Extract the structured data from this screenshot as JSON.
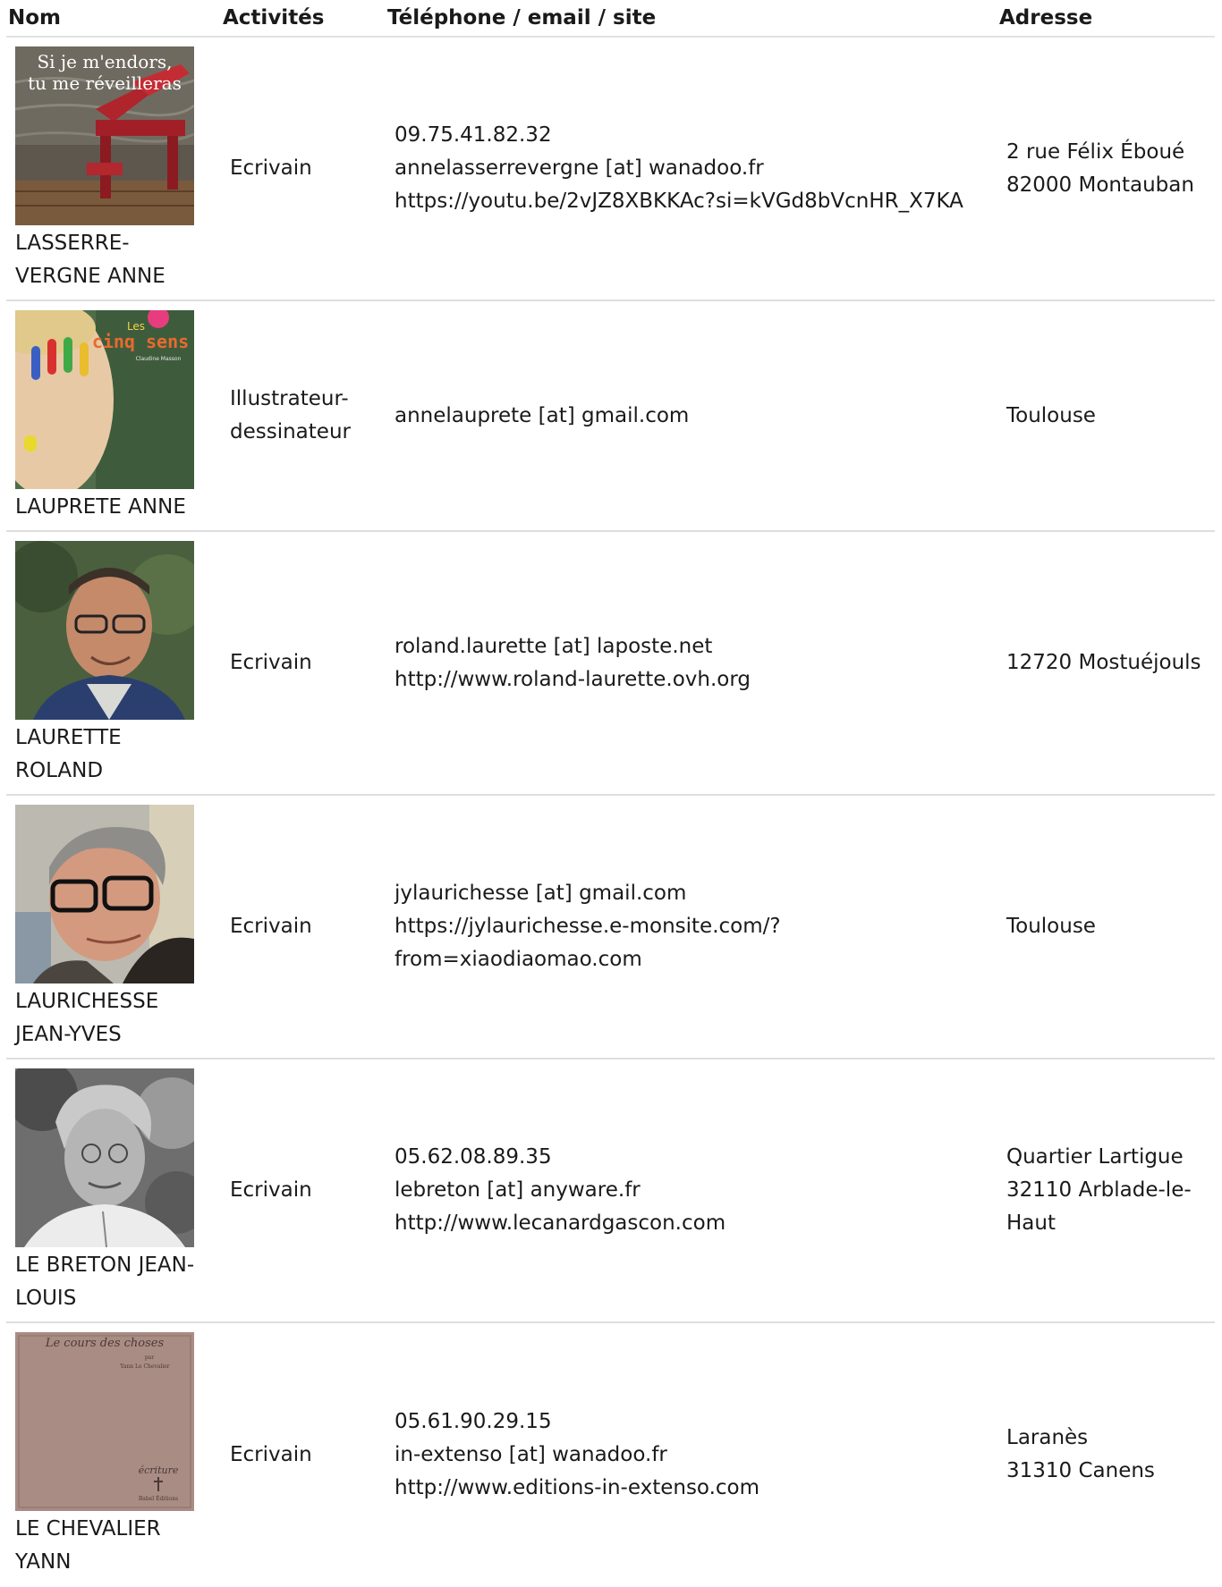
{
  "table": {
    "headers": {
      "nom": "Nom",
      "activites": "Activités",
      "contact": "Téléphone / email / site",
      "adresse": "Adresse"
    },
    "rows": [
      {
        "name": "LASSERRE-VERGNE ANNE",
        "photo_text": [
          "Si je m'endors,",
          "tu me réveilleras"
        ],
        "activity": "Ecrivain",
        "contact": [
          "09.75.41.82.32",
          "annelasserrevergne [at] wanadoo.fr",
          "https://youtu.be/2vJZ8XBKKAc?si=kVGd8bVcnHR_X7KA"
        ],
        "address": [
          "2 rue Félix Éboué",
          "82000 Montauban"
        ]
      },
      {
        "name": "LAUPRETE ANNE",
        "photo_text": [
          "Les",
          "cinq sens",
          "Claudine Masson"
        ],
        "activity": "Illustrateur-dessinateur",
        "contact": [
          "annelauprete [at] gmail.com"
        ],
        "address": [
          "Toulouse"
        ]
      },
      {
        "name": "LAURETTE ROLAND",
        "activity": "Ecrivain",
        "contact": [
          "roland.laurette [at] laposte.net",
          "http://www.roland-laurette.ovh.org"
        ],
        "address": [
          "12720 Mostuéjouls"
        ]
      },
      {
        "name": "LAURICHESSE JEAN-YVES",
        "activity": "Ecrivain",
        "contact": [
          "jylaurichesse [at] gmail.com",
          "https://jylaurichesse.e-monsite.com/?from=xiaodiaomao.com"
        ],
        "address": [
          "Toulouse"
        ]
      },
      {
        "name": "LE BRETON JEAN-LOUIS",
        "activity": "Ecrivain",
        "contact": [
          "05.62.08.89.35",
          "lebreton [at] anyware.fr",
          "http://www.lecanardgascon.com"
        ],
        "address": [
          "Quartier Lartigue",
          "32110 Arblade-le-Haut"
        ]
      },
      {
        "name": "LE CHEVALIER YANN",
        "photo_text": [
          "Le cours des choses",
          "par",
          "Yann Le Chevalier",
          "écriture",
          "Babel Éditions"
        ],
        "activity": "Ecrivain",
        "contact": [
          "05.61.90.29.15",
          "in-extenso [at] wanadoo.fr",
          "http://www.editions-in-extenso.com"
        ],
        "address": [
          "Laranès",
          "31310 Canens"
        ]
      }
    ]
  }
}
